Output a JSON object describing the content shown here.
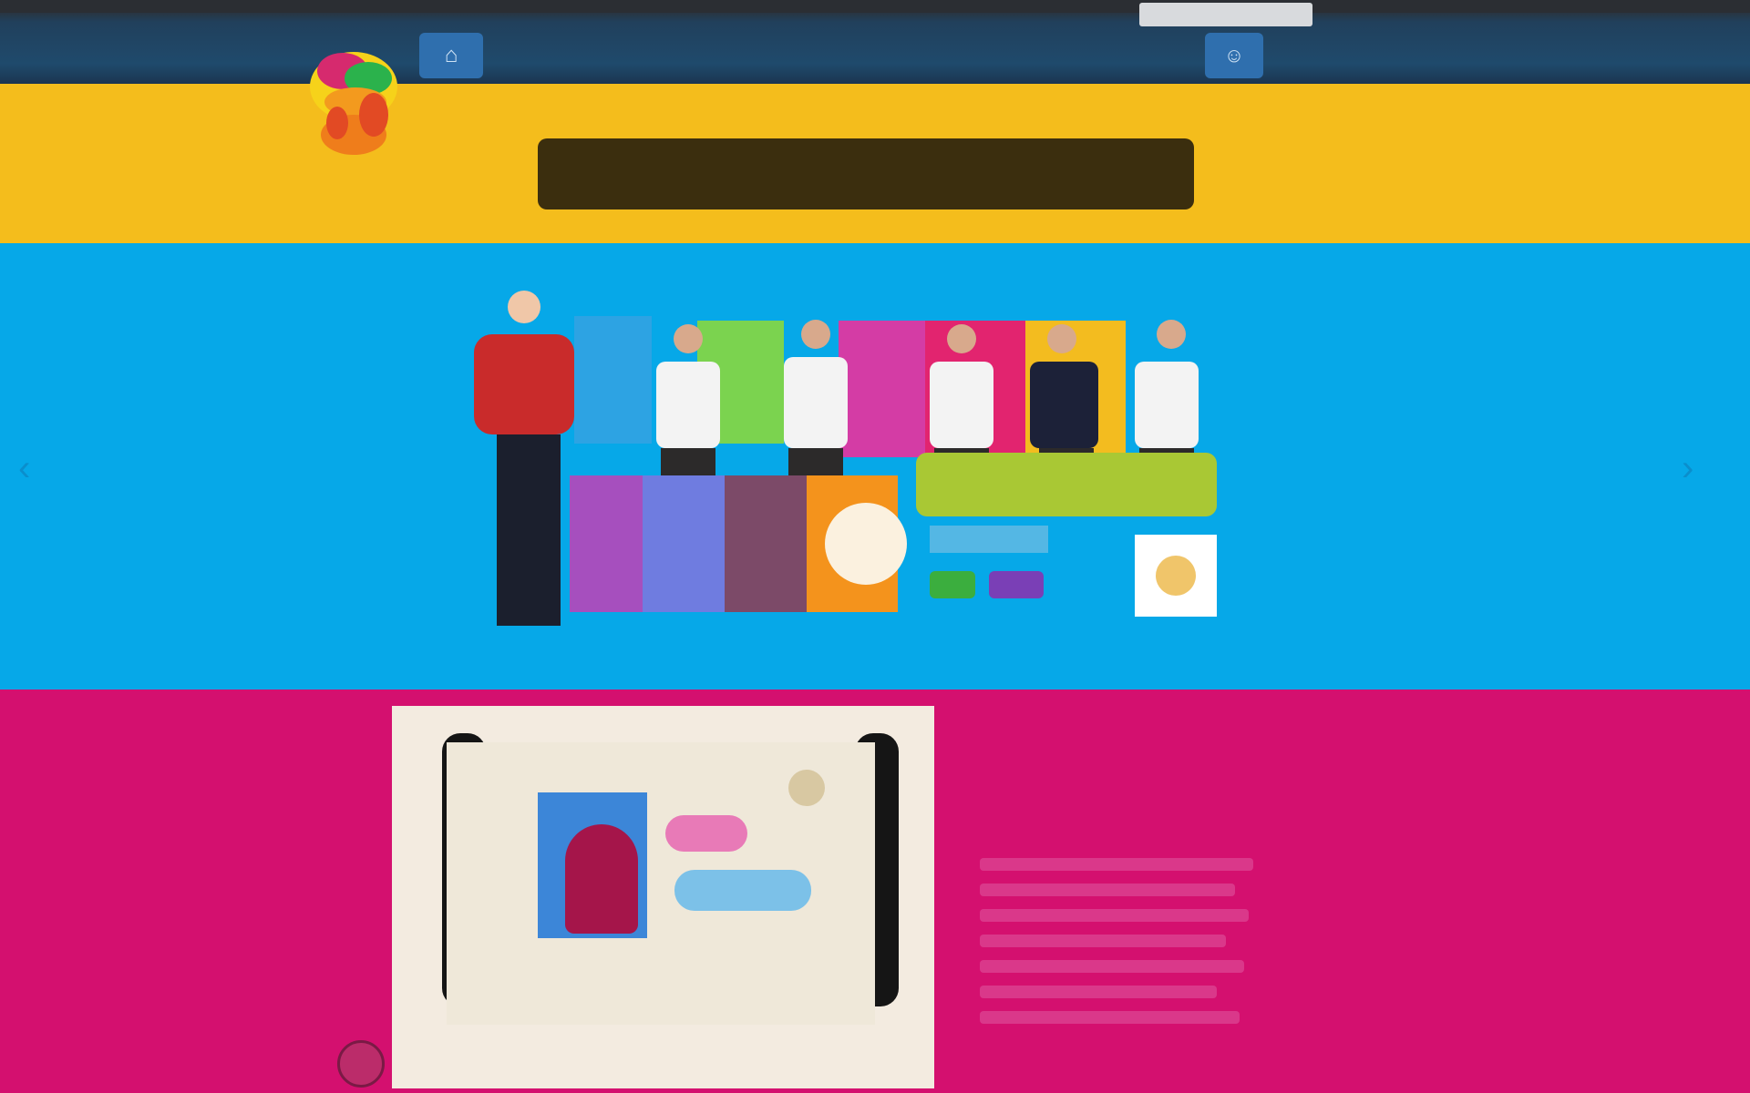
{
  "header": {
    "search_placeholder": "",
    "nav_items": [
      "",
      "",
      "",
      ""
    ],
    "right_links": [
      "",
      ""
    ],
    "right_extra": ""
  },
  "banner": {
    "text": ""
  },
  "hero": {
    "prev_arrow": "‹",
    "next_arrow": "›"
  },
  "latest": {
    "title": "",
    "subtitle": ""
  },
  "colors": {
    "yellow": "#f4bd1c",
    "blue": "#06a8e8",
    "magenta": "#d4106f",
    "navy": "#1f4a6c"
  }
}
